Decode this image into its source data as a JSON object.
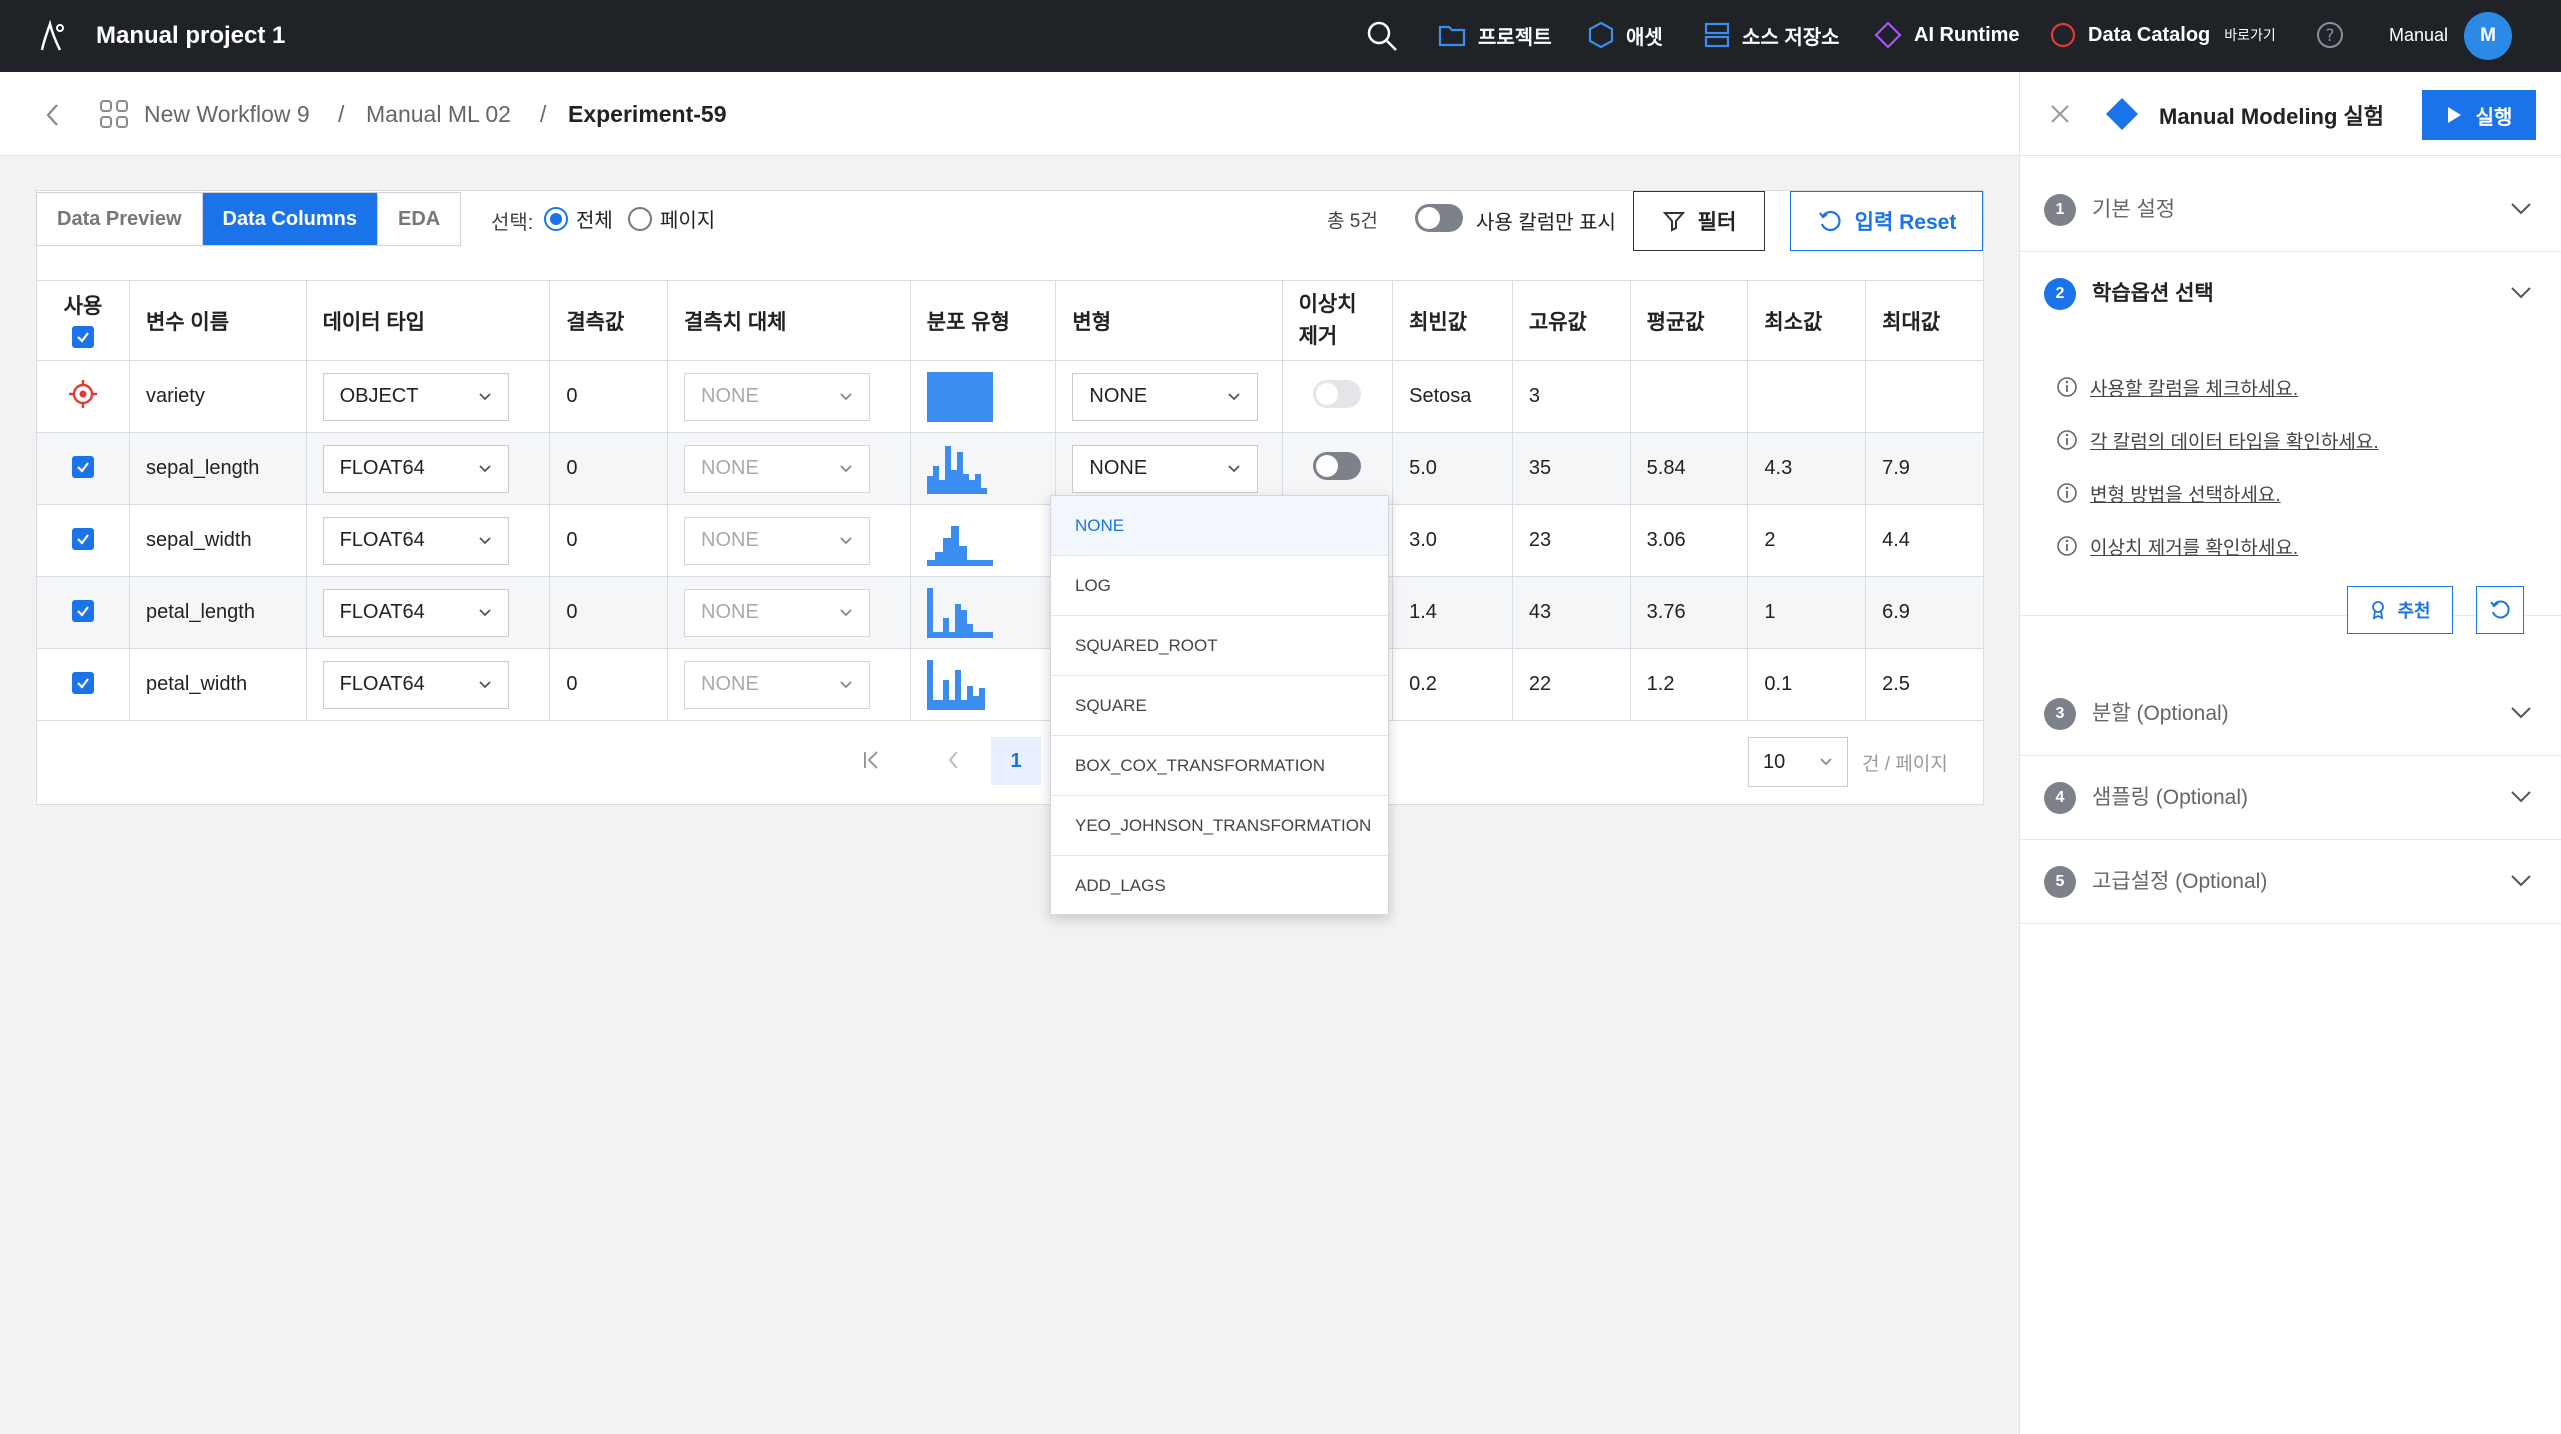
{
  "topnav": {
    "project_title": "Manual project 1",
    "items": [
      {
        "label": "프로젝트",
        "icon": "folder-icon"
      },
      {
        "label": "애셋",
        "icon": "hexagon-icon"
      },
      {
        "label": "소스 저장소",
        "icon": "storage-icon"
      },
      {
        "label": "AI Runtime",
        "icon": "diamond-icon"
      },
      {
        "label": "Data Catalog",
        "sub": "바로가기",
        "icon": "circle-icon"
      }
    ],
    "user_name": "Manual",
    "avatar_initial": "M"
  },
  "breadcrumb": {
    "items": [
      "New Workflow 9",
      "Manual ML 02",
      "Experiment-59"
    ],
    "separator": "/"
  },
  "toolbar": {
    "tabs": [
      "Data Preview",
      "Data Columns",
      "EDA"
    ],
    "active_tab": "Data Columns",
    "select_label": "선택:",
    "radio_all": "전체",
    "radio_page": "페이지",
    "total_count": "총 5건",
    "used_only_label": "사용 칼럼만 표시",
    "filter_label": "필터",
    "reset_label": "입력 Reset"
  },
  "table": {
    "headers": {
      "use": "사용",
      "name": "변수 이름",
      "dtype": "데이터 타입",
      "missing": "결측값",
      "impute": "결측치 대체",
      "dist": "분포 유형",
      "transform": "변형",
      "outlier": "이상치 제거",
      "mode": "최빈값",
      "unique": "고유값",
      "mean": "평균값",
      "min": "최소값",
      "max": "최대값"
    },
    "rows": [
      {
        "name": "variety",
        "dtype": "OBJECT",
        "missing": "0",
        "impute": "NONE",
        "transform": "NONE",
        "mode": "Setosa",
        "unique": "3",
        "mean": "",
        "min": "",
        "max": ""
      },
      {
        "name": "sepal_length",
        "dtype": "FLOAT64",
        "missing": "0",
        "impute": "NONE",
        "transform": "NONE",
        "mode": "5.0",
        "unique": "35",
        "mean": "5.84",
        "min": "4.3",
        "max": "7.9"
      },
      {
        "name": "sepal_width",
        "dtype": "FLOAT64",
        "missing": "0",
        "impute": "NONE",
        "transform": "NONE",
        "mode": "3.0",
        "unique": "23",
        "mean": "3.06",
        "min": "2",
        "max": "4.4"
      },
      {
        "name": "petal_length",
        "dtype": "FLOAT64",
        "missing": "0",
        "impute": "NONE",
        "transform": "NONE",
        "mode": "1.4",
        "unique": "43",
        "mean": "3.76",
        "min": "1",
        "max": "6.9"
      },
      {
        "name": "petal_width",
        "dtype": "FLOAT64",
        "missing": "0",
        "impute": "NONE",
        "transform": "NONE",
        "mode": "0.2",
        "unique": "22",
        "mean": "1.2",
        "min": "0.1",
        "max": "2.5"
      }
    ]
  },
  "dropdown": {
    "options": [
      "NONE",
      "LOG",
      "SQUARED_ROOT",
      "SQUARE",
      "BOX_COX_TRANSFORMATION",
      "YEO_JOHNSON_TRANSFORMATION",
      "ADD_LAGS"
    ],
    "selected": "NONE"
  },
  "pagination": {
    "current_page": "1",
    "page_size": "10",
    "page_size_suffix": "건 / 페이지"
  },
  "right_panel": {
    "title": "Manual Modeling 실험",
    "run_label": "실행",
    "sections": [
      {
        "num": "1",
        "title": "기본 설정"
      },
      {
        "num": "2",
        "title": "학습옵션 선택"
      },
      {
        "num": "3",
        "title": "분할 (Optional)"
      },
      {
        "num": "4",
        "title": "샘플링 (Optional)"
      },
      {
        "num": "5",
        "title": "고급설정 (Optional)"
      }
    ],
    "tips": [
      "사용할 칼럼을 체크하세요.",
      "각 칼럼의 데이터 타입을 확인하세요.",
      "변형 방법을 선택하세요.",
      "이상치 제거를 확인하세요."
    ],
    "recommend_label": "추천"
  },
  "colors": {
    "accent": "#1a73e8",
    "topbar": "#1f2227",
    "target_red": "#e53935",
    "hist_blue": "#3b8ef0"
  }
}
